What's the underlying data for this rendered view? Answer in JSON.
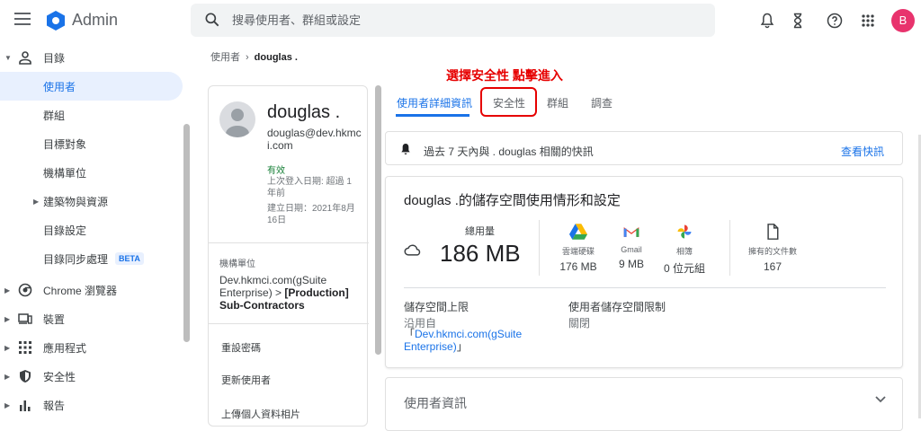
{
  "header": {
    "brand": "Admin",
    "search_placeholder": "搜尋使用者、群組或設定",
    "avatar_letter": "B"
  },
  "sidebar": {
    "items": [
      {
        "label": "目錄",
        "level": 0,
        "expanded": true
      },
      {
        "label": "使用者",
        "level": 1,
        "active": true
      },
      {
        "label": "群組",
        "level": 1
      },
      {
        "label": "目標對象",
        "level": 1
      },
      {
        "label": "機構單位",
        "level": 1
      },
      {
        "label": "建築物與資源",
        "level": 1,
        "collapsed": true
      },
      {
        "label": "目錄設定",
        "level": 1
      },
      {
        "label": "目錄同步處理",
        "level": 1,
        "badge": "BETA"
      },
      {
        "label": "Chrome 瀏覽器",
        "level": 0
      },
      {
        "label": "裝置",
        "level": 0
      },
      {
        "label": "應用程式",
        "level": 0
      },
      {
        "label": "安全性",
        "level": 0
      },
      {
        "label": "報告",
        "level": 0
      }
    ]
  },
  "breadcrumb": {
    "parent": "使用者",
    "separator": "›",
    "current": "douglas ."
  },
  "profile": {
    "name": "douglas .",
    "email": "douglas@dev.hkmci.com",
    "status": "有效",
    "last_login": "上次登入日期: 超過 1 年前",
    "created": "建立日期：2021年8月16日",
    "org_label": "機構單位",
    "org_parent": "Dev.hkmci.com(gSuite Enterprise)",
    "org_arrow": ">",
    "org_child": "[Production] Sub-Contractors",
    "actions": [
      "重設密碼",
      "更新使用者",
      "上傳個人資料相片"
    ]
  },
  "annotation": "選擇安全性 點擊進入",
  "tabs": [
    {
      "label": "使用者詳細資訊",
      "active": true
    },
    {
      "label": "安全性"
    },
    {
      "label": "群組"
    },
    {
      "label": "調查"
    }
  ],
  "alert": {
    "text": "過去 7 天內與 . douglas 相關的快訊",
    "link": "查看快訊"
  },
  "storage": {
    "title": "douglas .的儲存空間使用情形和設定",
    "total_label": "總用量",
    "total_value": "186 MB",
    "services": [
      {
        "icon": "google-drive-icon",
        "label": "雲端硬碟",
        "value": "176 MB"
      },
      {
        "icon": "gmail-icon",
        "label": "Gmail",
        "value": "9 MB"
      },
      {
        "icon": "google-photos-icon",
        "label": "相簿",
        "value": "0 位元組"
      },
      {
        "icon": "document-icon",
        "label": "擁有的文件數",
        "value": "167"
      }
    ],
    "limit_label": "儲存空間上限",
    "limit_sub": "沿用自",
    "limit_open": "「",
    "limit_link": "Dev.hkmci.com(gSuite Enterprise)",
    "limit_close": "」",
    "user_limit_label": "使用者儲存空間限制",
    "user_limit_value": "關閉"
  },
  "user_info": {
    "title": "使用者資訊"
  },
  "colors": {
    "accent": "#1a73e8",
    "annotation": "#e60000",
    "avatar": "#e8336d",
    "status_ok": "#188038"
  }
}
